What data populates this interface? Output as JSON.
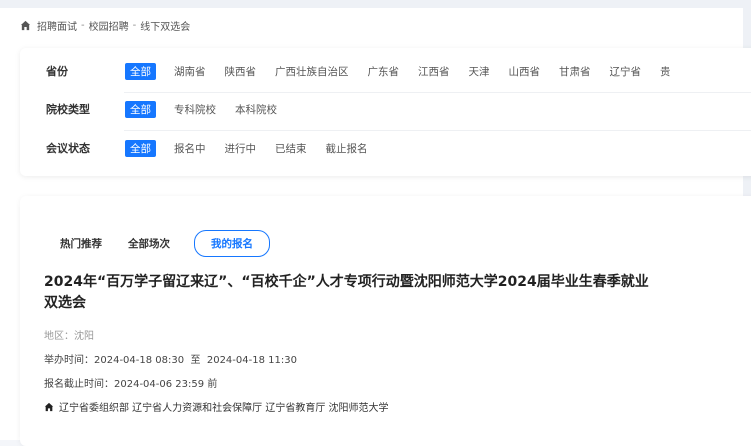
{
  "breadcrumb": {
    "items": [
      "招聘面试",
      "校园招聘",
      "线下双选会"
    ],
    "separator": "-"
  },
  "filters": {
    "province": {
      "label": "省份",
      "options": [
        "全部",
        "湖南省",
        "陕西省",
        "广西壮族自治区",
        "广东省",
        "江西省",
        "天津",
        "山西省",
        "甘肃省",
        "辽宁省",
        "贵"
      ],
      "selected": "全部"
    },
    "school_type": {
      "label": "院校类型",
      "options": [
        "全部",
        "专科院校",
        "本科院校"
      ],
      "selected": "全部"
    },
    "meeting_status": {
      "label": "会议状态",
      "options": [
        "全部",
        "报名中",
        "进行中",
        "已结束",
        "截止报名"
      ],
      "selected": "全部"
    }
  },
  "tabs": [
    {
      "label": "热门推荐",
      "active": false
    },
    {
      "label": "全部场次",
      "active": false
    },
    {
      "label": "我的报名",
      "active": true
    }
  ],
  "event": {
    "title": "2024年“百万学子留辽来辽”、“百校千企”人才专项行动暨沈阳师范大学2024届毕业生春季就业双选会",
    "region_label": "地区：",
    "region": "沈阳",
    "time_label": "举办时间：",
    "start": "2024-04-18 08:30",
    "to": "至",
    "end": "2024-04-18 11:30",
    "deadline_label": "报名截止时间：",
    "deadline": "2024-04-06 23:59",
    "deadline_suffix": "前",
    "organizers": "辽宁省委组织部 辽宁省人力资源和社会保障厅 辽宁省教育厅 沈阳师范大学"
  },
  "colors": {
    "accent": "#1677ff",
    "background": "#f4f6fa"
  }
}
